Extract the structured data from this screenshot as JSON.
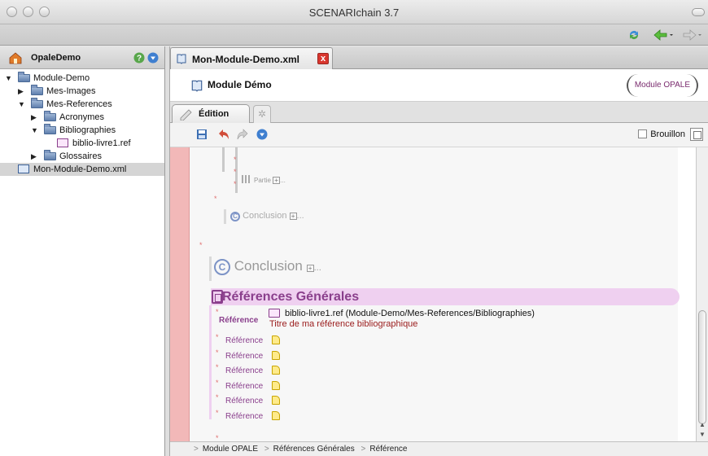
{
  "window": {
    "title": "SCENARIchain 3.7"
  },
  "workspace": {
    "name": "OpaleDemo"
  },
  "tree": [
    {
      "label": "Module-Demo",
      "indent": 0,
      "expanded": true,
      "kind": "folder"
    },
    {
      "label": "Mes-Images",
      "indent": 1,
      "expanded": false,
      "kind": "folder"
    },
    {
      "label": "Mes-References",
      "indent": 1,
      "expanded": true,
      "kind": "folder"
    },
    {
      "label": "Acronymes",
      "indent": 2,
      "expanded": false,
      "kind": "folder"
    },
    {
      "label": "Bibliographies",
      "indent": 2,
      "expanded": true,
      "kind": "folder"
    },
    {
      "label": "biblio-livre1.ref",
      "indent": 3,
      "kind": "ref"
    },
    {
      "label": "Glossaires",
      "indent": 2,
      "expanded": false,
      "kind": "folder"
    },
    {
      "label": "Mon-Module-Demo.xml",
      "indent": 0,
      "kind": "xml",
      "selected": true
    }
  ],
  "doc_tab": {
    "label": "Mon-Module-Demo.xml",
    "close": "x"
  },
  "header": {
    "title": "Module Démo",
    "model": "Module OPALE"
  },
  "sub_tabs": {
    "edit_label": "Édition"
  },
  "toolbar": {
    "draft_label": "Brouillon"
  },
  "content": {
    "partie_label": "Partie",
    "conclusion_small": "Conclusion",
    "conclusion_large": "Conclusion",
    "ellipsis": "...",
    "refs_title": "Références Générales",
    "ref_first_label": "Référence",
    "ref_first_link": "biblio-livre1.ref",
    "ref_first_path": "(Module-Demo/Mes-References/Bibliographies)",
    "ref_first_sub": "Titre de ma référence bibliographique",
    "ref_rows": [
      "Référence",
      "Référence",
      "Référence",
      "Référence",
      "Référence",
      "Référence"
    ]
  },
  "breadcrumb": [
    "Module OPALE",
    "Références Générales",
    "Référence"
  ],
  "colors": {
    "accent": "#8a3f8c",
    "margin": "#f2b8b8",
    "ref_sub": "#9a1b1b"
  }
}
